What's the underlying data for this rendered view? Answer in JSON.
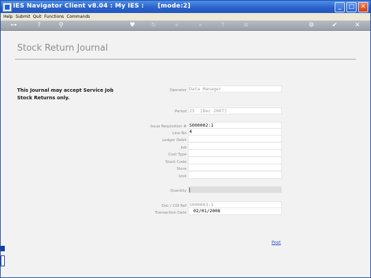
{
  "window": {
    "title": "IES Navigator Client v8.04 : My IES :      [mode:2]"
  },
  "menu": [
    "Help",
    "Submit",
    "Quit",
    "Functions",
    "Commands"
  ],
  "toolbar": [
    {
      "icon": "key-icon",
      "glyph": "⊶",
      "active": true
    },
    {
      "icon": "help-icon",
      "glyph": "?",
      "active": true
    },
    {
      "icon": "search-icon",
      "glyph": "⚲",
      "active": true
    },
    {
      "icon": "favorite-icon",
      "glyph": "♥",
      "active": true
    },
    {
      "icon": "refresh-icon",
      "glyph": "↻",
      "active": false
    },
    {
      "icon": "first-page-icon",
      "glyph": "«",
      "active": false
    },
    {
      "icon": "last-page-icon",
      "glyph": "»",
      "active": false
    },
    {
      "icon": "up-icon",
      "glyph": "↑",
      "active": false
    },
    {
      "icon": "list-icon",
      "glyph": "≡",
      "active": false
    },
    {
      "icon": "settings-icon",
      "glyph": "⚙",
      "active": true
    },
    {
      "icon": "ok-icon",
      "glyph": "✔",
      "active": true
    },
    {
      "icon": "cancel-icon",
      "glyph": "✕",
      "active": true
    }
  ],
  "page": {
    "title": "Stock Return Journal",
    "note_line1": "This Journal may accept Service Job",
    "note_line2": "Stock Returns only."
  },
  "fields": {
    "operator": {
      "label": "Operator",
      "value": "Data Manager"
    },
    "period": {
      "label": "Period",
      "value": "23  [Dec 2007]"
    },
    "issue_requisition": {
      "label": "Issue Requisition #",
      "value": "S000002:1"
    },
    "line_no": {
      "label": "Line No",
      "value": "4"
    },
    "ledger_debit": {
      "label": "Ledger Debit",
      "value": ""
    },
    "job": {
      "label": "Job",
      "value": ""
    },
    "cost_type": {
      "label": "Cost Type",
      "value": ""
    },
    "stock_code": {
      "label": "Stock Code",
      "value": ""
    },
    "store": {
      "label": "Store",
      "value": ""
    },
    "unit": {
      "label": "Unit",
      "value": ""
    },
    "quantity": {
      "label": "Quantity",
      "value": ""
    },
    "doc_cdi_ref": {
      "label": "Doc / CDI Ref",
      "value": "S000003:1"
    },
    "transaction_date": {
      "label": "Transaction Date",
      "value": "02/01/2008"
    }
  },
  "actions": {
    "post": "Post"
  }
}
